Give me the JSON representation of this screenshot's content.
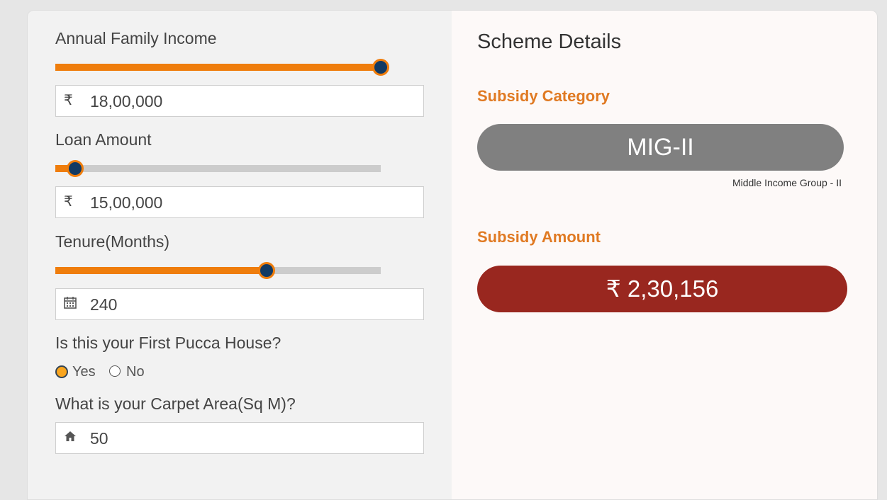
{
  "form": {
    "income": {
      "label": "Annual Family Income",
      "currency_icon": "₹",
      "value": "18,00,000",
      "slider_fraction": 1.0
    },
    "loan": {
      "label": "Loan Amount",
      "currency_icon": "₹",
      "value": "15,00,000",
      "slider_fraction": 0.06
    },
    "tenure": {
      "label": "Tenure(Months)",
      "icon": "calendar-icon",
      "value": "240",
      "slider_fraction": 0.65
    },
    "first_house": {
      "label": "Is this your First Pucca House?",
      "yes_label": "Yes",
      "no_label": "No",
      "selected": "Yes"
    },
    "carpet": {
      "label": "What is your Carpet Area(Sq M)?",
      "icon": "home-icon",
      "value": "50"
    }
  },
  "scheme": {
    "title": "Scheme Details",
    "category_heading": "Subsidy Category",
    "category_value": "MIG-II",
    "category_note": "Middle Income Group - II",
    "amount_heading": "Subsidy Amount",
    "amount_value": "₹ 2,30,156"
  },
  "colors": {
    "accent_orange": "#ef7d0c",
    "heading_orange": "#e07a23",
    "thumb_navy": "#123a63",
    "category_grey": "#808080",
    "amount_red": "#99271f"
  }
}
